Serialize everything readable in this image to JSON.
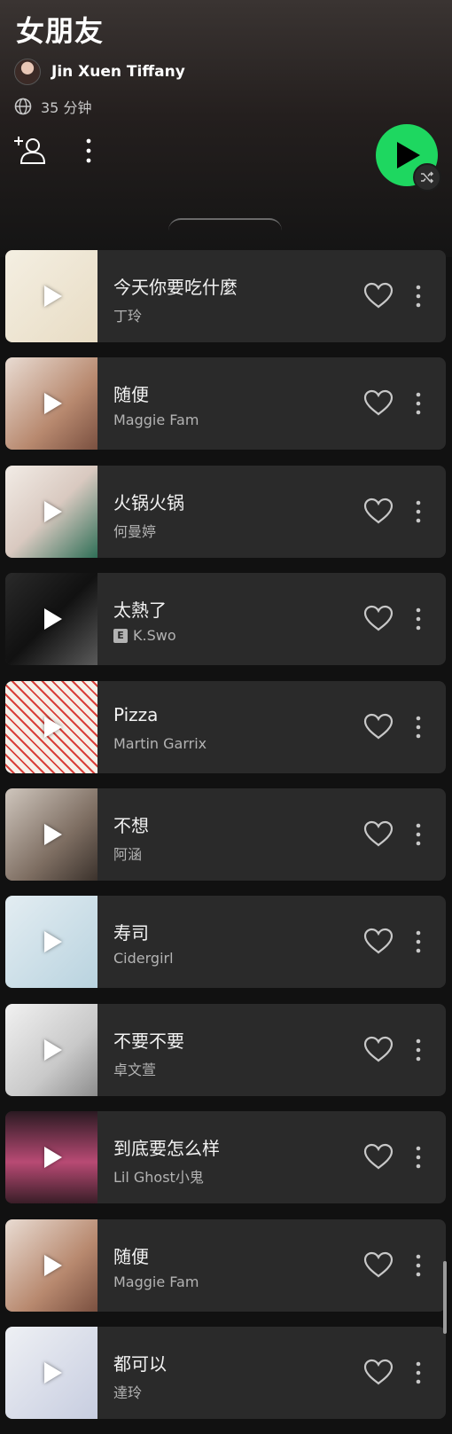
{
  "playlist": {
    "title": "女朋友",
    "owner": "Jin Xuen Tiffany",
    "duration": "35 分钟"
  },
  "colors": {
    "accent": "#1ed760",
    "background": "#111111",
    "card": "#2a2a2a"
  },
  "icons": [
    "globe-icon",
    "add-user-icon",
    "more-icon",
    "play-icon",
    "shuffle-icon",
    "heart-icon",
    "explicit-icon"
  ],
  "tracks": [
    {
      "title": "今天你要吃什麼",
      "artist": "丁玲",
      "explicit": false,
      "cover_bg": "linear-gradient(135deg,#f4efe2,#e8dcc4)"
    },
    {
      "title": "随便",
      "artist": "Maggie Fam",
      "explicit": false,
      "cover_bg": "linear-gradient(135deg,#e9dcd3,#b8896f 60%,#7a5040)"
    },
    {
      "title": "火锅火锅",
      "artist": "何曼婷",
      "explicit": false,
      "cover_bg": "linear-gradient(135deg,#f2ece6,#d9c9c0 50%,#2f6f57)"
    },
    {
      "title": "太熱了",
      "artist": "K.Swo",
      "explicit": true,
      "cover_bg": "linear-gradient(135deg,#2a2a2a,#111 50%,#5a5a5a)"
    },
    {
      "title": "Pizza",
      "artist": "Martin Garrix",
      "explicit": false,
      "cover_bg": "repeating-linear-gradient(45deg,#f6f1ea 0 6px,#d9403a 6px 8px)"
    },
    {
      "title": "不想",
      "artist": "阿涵",
      "explicit": false,
      "cover_bg": "linear-gradient(135deg,#cfc6bd,#7e6e62 60%,#3b322c)"
    },
    {
      "title": "寿司",
      "artist": "Cidergirl",
      "explicit": false,
      "cover_bg": "linear-gradient(135deg,#e3edf2,#b9d3df)"
    },
    {
      "title": "不要不要",
      "artist": "卓文萱",
      "explicit": false,
      "cover_bg": "linear-gradient(135deg,#f1f1f1,#c9c9c9 60%,#8d8d8d)"
    },
    {
      "title": "到底要怎么样",
      "artist": "Lil Ghost小鬼",
      "explicit": false,
      "cover_bg": "linear-gradient(180deg,#2b1a22,#b84a74 55%,#3a1e28)"
    },
    {
      "title": "随便",
      "artist": "Maggie Fam",
      "explicit": false,
      "cover_bg": "linear-gradient(135deg,#e9dcd3,#b8896f 60%,#7a5040)"
    },
    {
      "title": "都可以",
      "artist": "達玲",
      "explicit": false,
      "cover_bg": "linear-gradient(135deg,#eef0f4,#c7cde0)"
    }
  ]
}
